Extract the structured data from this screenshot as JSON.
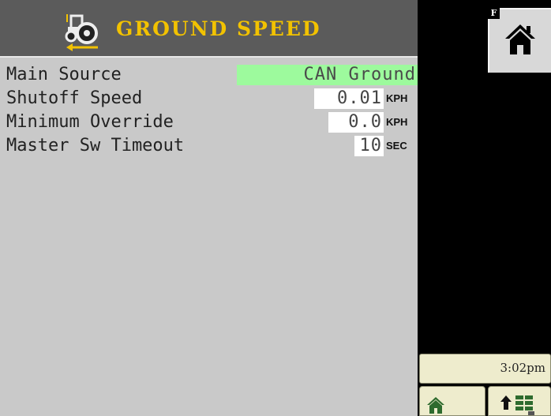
{
  "header": {
    "title": "GROUND SPEED",
    "icon": "tractor-icon"
  },
  "settings": [
    {
      "label": "Main Source",
      "value": "CAN Ground",
      "unit": ""
    },
    {
      "label": "Shutoff Speed",
      "value": "0.01",
      "unit": "KPH"
    },
    {
      "label": "Minimum Override",
      "value": "0.0",
      "unit": "KPH"
    },
    {
      "label": "Master Sw Timeout",
      "value": "10",
      "unit": "SEC"
    }
  ],
  "sidebar": {
    "badge": "F",
    "home_icon": "home-icon",
    "clock": "3:02pm"
  },
  "bottom_tabs": [
    {
      "icon": "home-icon"
    },
    {
      "icon": "up-arrow-grid-icon"
    }
  ],
  "colors": {
    "title": "#f2c200",
    "highlight": "#9dfa9d",
    "header_bg": "#5b5b5b",
    "panel_bg": "#c9c9c9"
  }
}
